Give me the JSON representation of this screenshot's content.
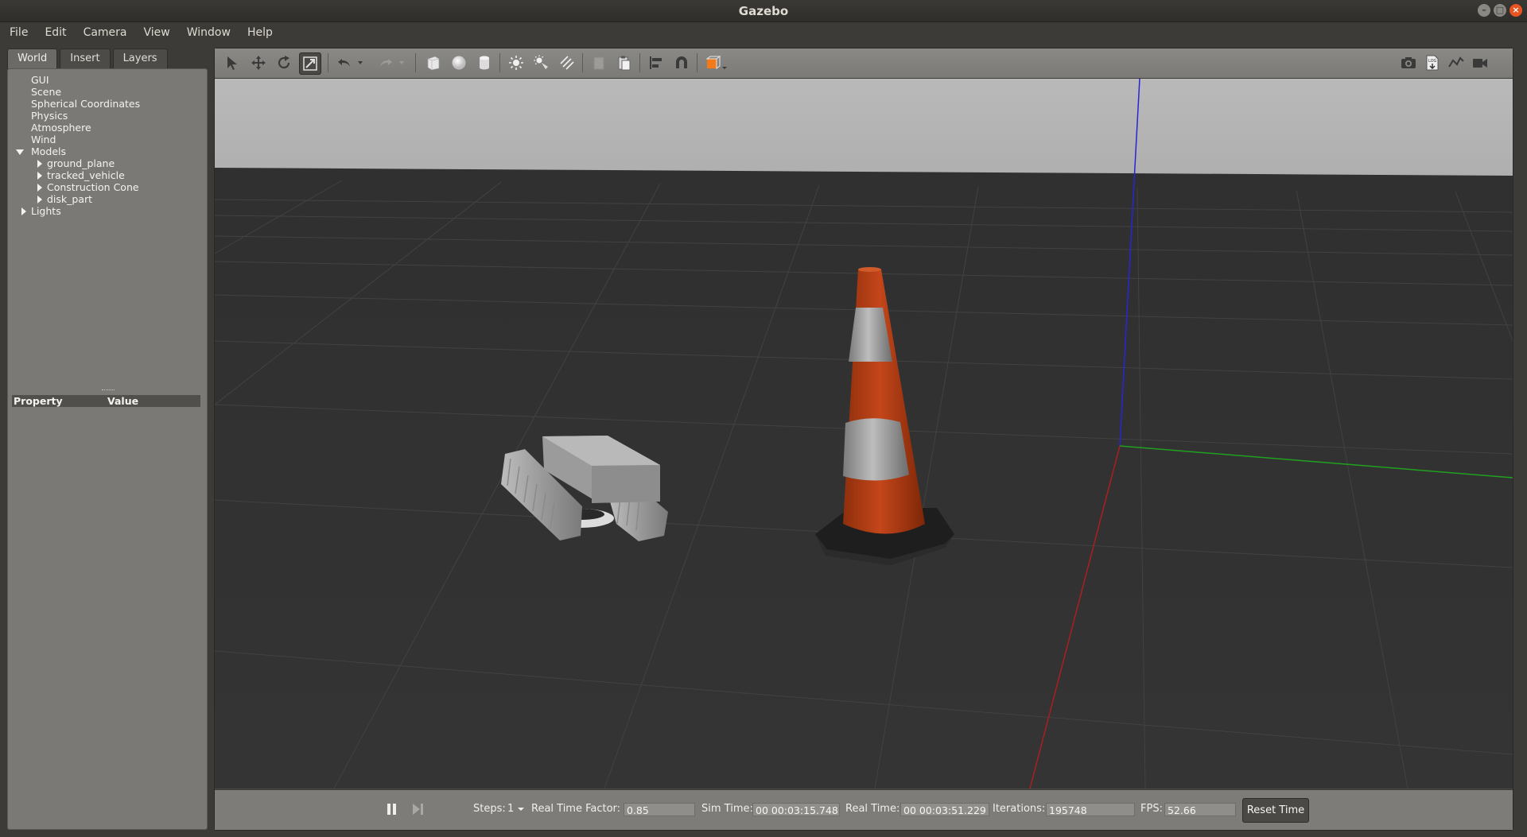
{
  "window": {
    "title": "Gazebo"
  },
  "menu": [
    "File",
    "Edit",
    "Camera",
    "View",
    "Window",
    "Help"
  ],
  "left_panel": {
    "tabs": [
      "World",
      "Insert",
      "Layers"
    ],
    "active_tab": "World",
    "tree": {
      "items": [
        "GUI",
        "Scene",
        "Spherical Coordinates",
        "Physics",
        "Atmosphere",
        "Wind"
      ],
      "models_label": "Models",
      "models": [
        "ground_plane",
        "tracked_vehicle",
        "Construction Cone",
        "disk_part"
      ],
      "lights_label": "Lights"
    },
    "property_header": {
      "property": "Property",
      "value": "Value"
    }
  },
  "toolbar": {
    "tools": [
      "select-tool",
      "translate-tool",
      "rotate-tool",
      "scale-tool",
      "undo",
      "undo-history",
      "redo",
      "redo-history",
      "box-shape",
      "sphere-shape",
      "cylinder-shape",
      "point-light",
      "spot-light",
      "directional-light",
      "copy",
      "paste",
      "align",
      "snap",
      "view-angle"
    ],
    "right_tools": [
      "screenshot",
      "log",
      "plot",
      "video-record"
    ],
    "active_tool": "scale-tool"
  },
  "bottom_bar": {
    "steps_label": "Steps:",
    "steps_value": "1",
    "real_time_factor_label": "Real Time Factor:",
    "real_time_factor": "0.85",
    "sim_time_label": "Sim Time:",
    "sim_time": "00 00:03:15.748",
    "real_time_label": "Real Time:",
    "real_time": "00 00:03:51.229",
    "iterations_label": "Iterations:",
    "iterations": "195748",
    "fps_label": "FPS:",
    "fps": "52.66",
    "reset_time_label": "Reset Time"
  },
  "colors": {
    "window_bg": "#3c3b37",
    "panel_bg": "#7a7975",
    "sky": "#b4b4b4",
    "ground": "#333333",
    "cone_orange": "#c2410f",
    "axis_x": "#b22222",
    "axis_y": "#22aa22",
    "axis_z": "#2222dd",
    "close_button": "#e95420"
  }
}
